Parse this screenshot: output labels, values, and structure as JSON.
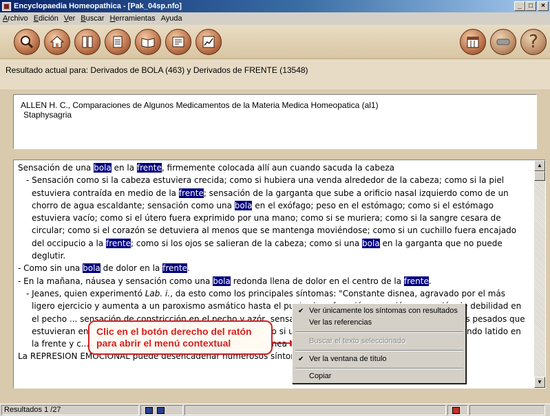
{
  "window": {
    "title": "Encyclopaedia Homeopathica - [Pak_04sp.nfo]",
    "min_label": "_",
    "max_label": "□",
    "close_label": "×"
  },
  "menu": [
    {
      "mnemonic": "A",
      "rest": "rchivo"
    },
    {
      "mnemonic": "E",
      "rest": "dición"
    },
    {
      "mnemonic": "V",
      "rest": "er"
    },
    {
      "mnemonic": "B",
      "rest": "uscar"
    },
    {
      "mnemonic": "H",
      "rest": "erramientas"
    },
    {
      "mnemonic": "",
      "rest": "Ayuda"
    }
  ],
  "toolbar_icons": [
    "search-icon",
    "home-icon",
    "book-icon",
    "document-icon",
    "open-book-icon",
    "list-icon",
    "chart-icon",
    "calendar-icon",
    "grey-logo-icon",
    "help-icon"
  ],
  "help_label": "?",
  "result_header": "Resultado actual para: Derivados de BOLA (463) y Derivados de FRENTE (13548)",
  "source": {
    "line1": "ALLEN H. C., Comparaciones de Algunos Medicamentos de la Materia Medica Homeopatica (al1)",
    "line2": "Staphysagria"
  },
  "text": {
    "l1": [
      "Sensación de una ",
      "bola",
      " en la ",
      "frente",
      ", firmemente colocada allí aun cuando sacuda la cabeza"
    ],
    "l2": [
      "- Sensación como si la cabeza estuviera crecida; como si hubiera una venda alrededor de la cabeza; como si la piel estuviera contraída en medio de la ",
      "frente",
      "; sensación de la garganta que sube a orificio nasal izquierdo como de un chorro de agua escaldante; sensación como una ",
      "bola",
      " en el exófago; peso en el estómago; como si el estómago estuviera vacío; como si el útero fuera exprimido por una mano; como si se muriera; como si la sangre cesara de circular; como si el corazón se detuviera al menos que se mantenga moviéndose; como si un cuchillo fuera encajado del occipucio a la ",
      "frente",
      "; como si los ojos se salieran de la cabeza; como si una ",
      "bola",
      " en la garganta que no puede deglutir."
    ],
    "l3": [
      "- Como sin una ",
      "bola",
      " de dolor en la ",
      "frente",
      "."
    ],
    "l4": [
      "- En la mañana, náusea y sensación como una ",
      "bola",
      " redonda llena de dolor en el centro de la ",
      "frente",
      "."
    ],
    "l5a": "- Jeanes, quien experimentó ",
    "l5b": "Lab. i.",
    "l5c": ", da esto como los principales síntomas: \"Constante disnea, agravado por el más ligero ejercicio y aumenta a un paroxismo asmático hasta el punto de sofocación; opresión; sensación de debilidad en el pecho ... sensación de constricción en el pecho y azór, sensación como una ",
    "l5d": "bola",
    "l5e": " o cantidad de cuerpos pesados que estuvieran en el pecho presionando unos sobre otros como si una sien a otra; dolor de cabeza con tremendo latido en la frente y c... ardor en el epigastrio, con opresión simultánea del corazón.",
    "l6": "La REPRESION EMOCIONAL puede desencadenar numerosos síntomas entre los cuales los principales serán"
  },
  "context_menu": {
    "item1": "Ver únicamente los síntomas con resultados",
    "item2": "Ver las referencias",
    "item3": "Buscar el texto seleccionado",
    "item4": "Ver la ventana de título",
    "item5": "Copiar"
  },
  "callout": "Clic en el botón derecho del ratón para abrir el menú contextual",
  "status": {
    "results": "Resultados 1 /27"
  },
  "colors": {
    "highlight": "#000080",
    "callout": "#d52020",
    "title_bar": "#0a246a"
  }
}
